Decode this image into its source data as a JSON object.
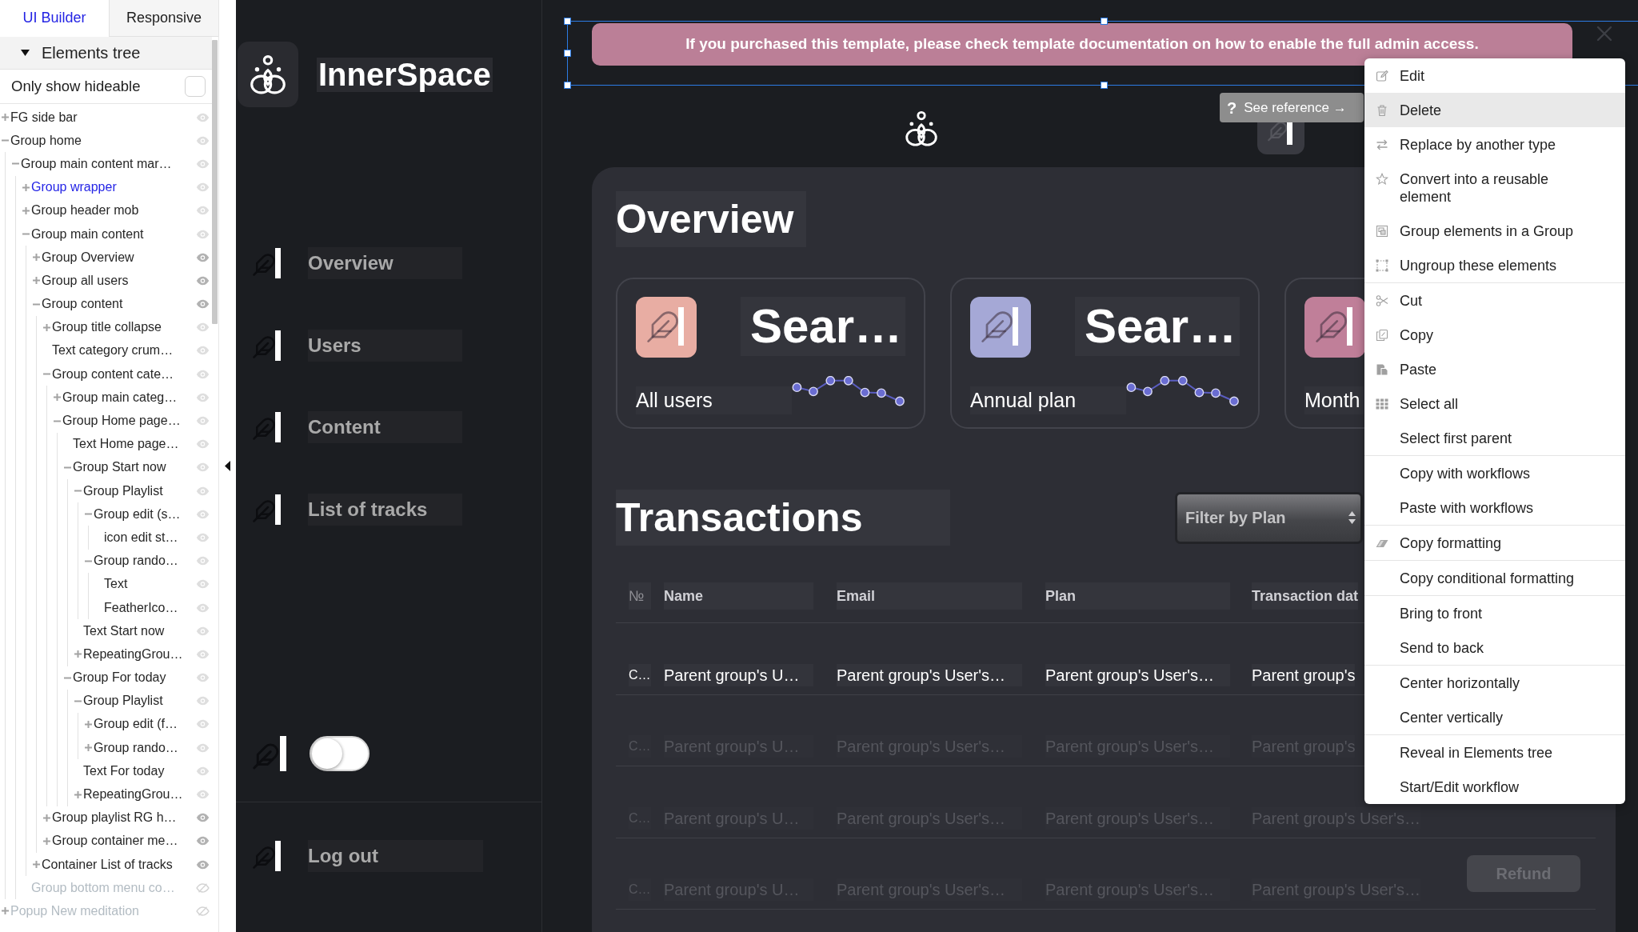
{
  "editor_tabs": [
    {
      "label": "UI Builder",
      "selected": true
    },
    {
      "label": "Responsive",
      "selected": false
    }
  ],
  "elements_tree": {
    "title": "Elements tree",
    "expanded": true,
    "filter": {
      "label": "Only show hideable",
      "checked": false
    },
    "items": [
      {
        "label": "FG side bar",
        "selected": false,
        "expandable": true,
        "expanded": false,
        "hidden": false,
        "eye_dark": false
      },
      {
        "label": "Group home",
        "selected": false,
        "expandable": true,
        "expanded": true,
        "hidden": false,
        "eye_dark": false,
        "children": [
          {
            "label": "Group main content mar…",
            "selected": false,
            "expandable": true,
            "expanded": true,
            "hidden": false,
            "eye_dark": false,
            "children": [
              {
                "label": "Group wrapper",
                "selected": true,
                "expandable": true,
                "expanded": false,
                "hidden": false,
                "eye_dark": false
              },
              {
                "label": "Group header mob",
                "selected": false,
                "expandable": true,
                "expanded": false,
                "hidden": false,
                "eye_dark": false
              },
              {
                "label": "Group main content",
                "selected": false,
                "expandable": true,
                "expanded": true,
                "hidden": false,
                "eye_dark": false,
                "children": [
                  {
                    "label": "Group Overview",
                    "selected": false,
                    "expandable": true,
                    "expanded": false,
                    "hidden": false,
                    "eye_dark": true
                  },
                  {
                    "label": "Group all users",
                    "selected": false,
                    "expandable": true,
                    "expanded": false,
                    "hidden": false,
                    "eye_dark": true
                  },
                  {
                    "label": "Group content",
                    "selected": false,
                    "expandable": true,
                    "expanded": true,
                    "hidden": false,
                    "eye_dark": true,
                    "children": [
                      {
                        "label": "Group title collapse",
                        "selected": false,
                        "expandable": true,
                        "expanded": false,
                        "hidden": false,
                        "eye_dark": false
                      },
                      {
                        "label": "Text category crum…",
                        "selected": false,
                        "expandable": false,
                        "expanded": false,
                        "hidden": false,
                        "eye_dark": false
                      },
                      {
                        "label": "Group content cate…",
                        "selected": false,
                        "expandable": true,
                        "expanded": true,
                        "hidden": false,
                        "eye_dark": false,
                        "children": [
                          {
                            "label": "Group main categ…",
                            "selected": false,
                            "expandable": true,
                            "expanded": false,
                            "hidden": false,
                            "eye_dark": false
                          },
                          {
                            "label": "Group Home page…",
                            "selected": false,
                            "expandable": true,
                            "expanded": true,
                            "hidden": false,
                            "eye_dark": false,
                            "children": [
                              {
                                "label": "Text Home page…",
                                "selected": false,
                                "expandable": false,
                                "expanded": false,
                                "hidden": false,
                                "eye_dark": false
                              },
                              {
                                "label": "Group Start now",
                                "selected": false,
                                "expandable": true,
                                "expanded": true,
                                "hidden": false,
                                "eye_dark": false,
                                "children": [
                                  {
                                    "label": "Group Playlist",
                                    "selected": false,
                                    "expandable": true,
                                    "expanded": true,
                                    "hidden": false,
                                    "eye_dark": false,
                                    "children": [
                                      {
                                        "label": "Group edit (s…",
                                        "selected": false,
                                        "expandable": true,
                                        "expanded": true,
                                        "hidden": false,
                                        "eye_dark": false,
                                        "children": [
                                          {
                                            "label": "icon edit st…",
                                            "selected": false,
                                            "expandable": false,
                                            "expanded": false,
                                            "hidden": false,
                                            "eye_dark": false
                                          }
                                        ]
                                      },
                                      {
                                        "label": "Group rando…",
                                        "selected": false,
                                        "expandable": true,
                                        "expanded": true,
                                        "hidden": false,
                                        "eye_dark": false,
                                        "children": [
                                          {
                                            "label": "Text",
                                            "selected": false,
                                            "expandable": false,
                                            "expanded": false,
                                            "hidden": false,
                                            "eye_dark": false
                                          },
                                          {
                                            "label": "FeatherIco…",
                                            "selected": false,
                                            "expandable": false,
                                            "expanded": false,
                                            "hidden": false,
                                            "eye_dark": false
                                          }
                                        ]
                                      }
                                    ]
                                  },
                                  {
                                    "label": "Text Start now",
                                    "selected": false,
                                    "expandable": false,
                                    "expanded": false,
                                    "hidden": false,
                                    "eye_dark": false
                                  },
                                  {
                                    "label": "RepeatingGrou…",
                                    "selected": false,
                                    "expandable": true,
                                    "expanded": false,
                                    "hidden": false,
                                    "eye_dark": false
                                  }
                                ]
                              },
                              {
                                "label": "Group For today",
                                "selected": false,
                                "expandable": true,
                                "expanded": true,
                                "hidden": false,
                                "eye_dark": false,
                                "children": [
                                  {
                                    "label": "Group Playlist",
                                    "selected": false,
                                    "expandable": true,
                                    "expanded": true,
                                    "hidden": false,
                                    "eye_dark": false,
                                    "children": [
                                      {
                                        "label": "Group edit (f…",
                                        "selected": false,
                                        "expandable": true,
                                        "expanded": false,
                                        "hidden": false,
                                        "eye_dark": false
                                      },
                                      {
                                        "label": "Group rando…",
                                        "selected": false,
                                        "expandable": true,
                                        "expanded": false,
                                        "hidden": false,
                                        "eye_dark": false
                                      }
                                    ]
                                  },
                                  {
                                    "label": "Text For today",
                                    "selected": false,
                                    "expandable": false,
                                    "expanded": false,
                                    "hidden": false,
                                    "eye_dark": false
                                  },
                                  {
                                    "label": "RepeatingGrou…",
                                    "selected": false,
                                    "expandable": true,
                                    "expanded": false,
                                    "hidden": false,
                                    "eye_dark": false
                                  }
                                ]
                              }
                            ]
                          }
                        ]
                      },
                      {
                        "label": "Group playlist RG h…",
                        "selected": false,
                        "expandable": true,
                        "expanded": false,
                        "hidden": false,
                        "eye_dark": true
                      },
                      {
                        "label": "Group container me…",
                        "selected": false,
                        "expandable": true,
                        "expanded": false,
                        "hidden": false,
                        "eye_dark": true
                      }
                    ]
                  },
                  {
                    "label": "Container List of tracks",
                    "selected": false,
                    "expandable": true,
                    "expanded": false,
                    "hidden": false,
                    "eye_dark": true
                  }
                ]
              },
              {
                "label": "Group bottom menu co…",
                "selected": false,
                "expandable": false,
                "expanded": false,
                "hidden": true,
                "eye_dark": false
              }
            ]
          }
        ]
      },
      {
        "label": "Popup New meditation",
        "selected": false,
        "expandable": true,
        "expanded": false,
        "hidden": true,
        "eye_dark": false
      }
    ]
  },
  "app": {
    "brand": "InnerSpace",
    "nav": [
      {
        "label": "Overview"
      },
      {
        "label": "Users"
      },
      {
        "label": "Content"
      },
      {
        "label": "List of tracks"
      }
    ],
    "toggle": {
      "on": false
    },
    "logout": "Log out"
  },
  "banner": {
    "text": "If you purchased this template, please check template documentation on how to enable the full admin access.",
    "selected": true
  },
  "tooltip": {
    "mark": "?",
    "label": "See reference →"
  },
  "overview": {
    "title": "Overview",
    "cards": [
      {
        "value": "Sear…",
        "label": "All users",
        "color": "#e8ada3"
      },
      {
        "value": "Sear…",
        "label": "Annual plan",
        "color": "#a5a8d6"
      },
      {
        "label": "Month",
        "color": "#c07f99"
      }
    ]
  },
  "transactions": {
    "title": "Transactions",
    "filter": {
      "placeholder": "Filter by Plan"
    },
    "columns": [
      "№",
      "Name",
      "Email",
      "Plan",
      "Transaction dat"
    ],
    "rows": [
      {
        "cells": [
          "C…",
          "Parent group's U…",
          "Parent group's User's…",
          "Parent group's User's…",
          "Parent group's"
        ],
        "dimmed": false
      },
      {
        "cells": [
          "C…",
          "Parent group's U…",
          "Parent group's User's…",
          "Parent group's User's…",
          "Parent group's"
        ],
        "dimmed": true
      },
      {
        "cells": [
          "C…",
          "Parent group's U…",
          "Parent group's User's…",
          "Parent group's User's…",
          "Parent group's User's…"
        ],
        "dimmed": true
      },
      {
        "cells": [
          "C…",
          "Parent group's U…",
          "Parent group's User's…",
          "Parent group's User's…",
          "Parent group's User's…"
        ],
        "dimmed": true,
        "button": "Refund"
      }
    ]
  },
  "context_menu": {
    "groups": [
      [
        {
          "label": "Edit",
          "kind": "edit",
          "highlighted": false
        },
        {
          "label": "Delete",
          "kind": "delete",
          "highlighted": true
        },
        {
          "label": "Replace by another type",
          "kind": "replace",
          "highlighted": false
        },
        {
          "label": "Convert into a reusable element",
          "kind": "convert",
          "highlighted": false
        },
        {
          "label": "Group elements in a Group",
          "kind": "group",
          "highlighted": false
        },
        {
          "label": "Ungroup these elements",
          "kind": "ungroup",
          "highlighted": false
        }
      ],
      [
        {
          "label": "Cut",
          "kind": "cut",
          "highlighted": false
        },
        {
          "label": "Copy",
          "kind": "copy",
          "highlighted": false
        },
        {
          "label": "Paste",
          "kind": "paste",
          "highlighted": false
        },
        {
          "label": "Select all",
          "kind": "grid",
          "highlighted": false
        },
        {
          "label": "Select first parent",
          "kind": "plain",
          "highlighted": false
        }
      ],
      [
        {
          "label": "Copy with workflows",
          "kind": "plain",
          "highlighted": false
        },
        {
          "label": "Paste with workflows",
          "kind": "plain",
          "highlighted": false
        }
      ],
      [
        {
          "label": "Copy formatting",
          "kind": "format",
          "highlighted": false
        }
      ],
      [
        {
          "label": "Copy conditional formatting",
          "kind": "plain",
          "highlighted": false
        }
      ],
      [
        {
          "label": "Bring to front",
          "kind": "plain",
          "highlighted": false
        },
        {
          "label": "Send to back",
          "kind": "plain",
          "highlighted": false
        }
      ],
      [
        {
          "label": "Center horizontally",
          "kind": "plain",
          "highlighted": false
        },
        {
          "label": "Center vertically",
          "kind": "plain",
          "highlighted": false
        }
      ],
      [
        {
          "label": "Reveal in Elements tree",
          "kind": "plain",
          "highlighted": false
        },
        {
          "label": "Start/Edit workflow",
          "kind": "plain",
          "highlighted": false
        }
      ]
    ]
  }
}
